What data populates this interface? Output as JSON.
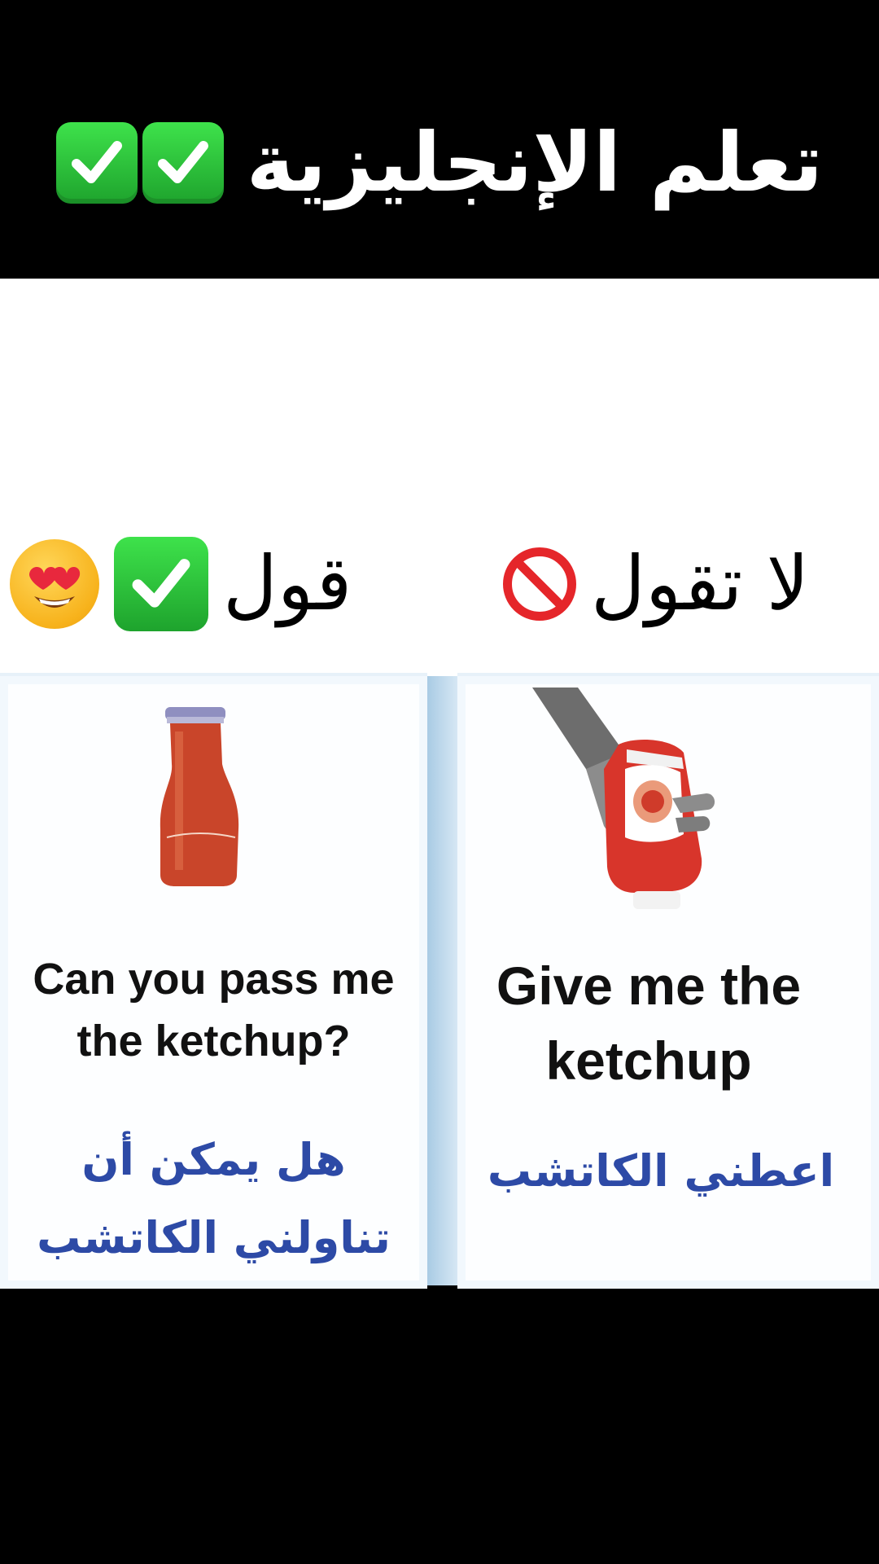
{
  "header": {
    "title": "تعلم الإنجليزية",
    "title_icons": [
      "check-mark-button-icon",
      "check-mark-button-icon"
    ]
  },
  "columns": {
    "say": {
      "heading": "قول",
      "icons": [
        "smiling-face-with-heart-eyes-icon",
        "check-mark-button-icon"
      ],
      "english_line1": "Can you pass me",
      "english_line2": "the ketchup?",
      "arabic_line1": "هل يمكن أن",
      "arabic_line2": "تناولني الكاتشب",
      "image": "ketchup-bottle-glass"
    },
    "dont_say": {
      "heading": "لا تقول",
      "icons": [
        "prohibited-icon"
      ],
      "english_line1": "Give me the",
      "english_line2": "ketchup",
      "arabic_line1": "اعطني الكاتشب",
      "image": "hand-holding-heinz-ketchup"
    }
  },
  "colors": {
    "banner_bg": "#000000",
    "content_bg": "#ffffff",
    "check_green": "#2bc23a",
    "arabic_blue": "#2d4aa6",
    "prohibit_red": "#e5262a",
    "divider_blue": "#a9cbe4"
  }
}
